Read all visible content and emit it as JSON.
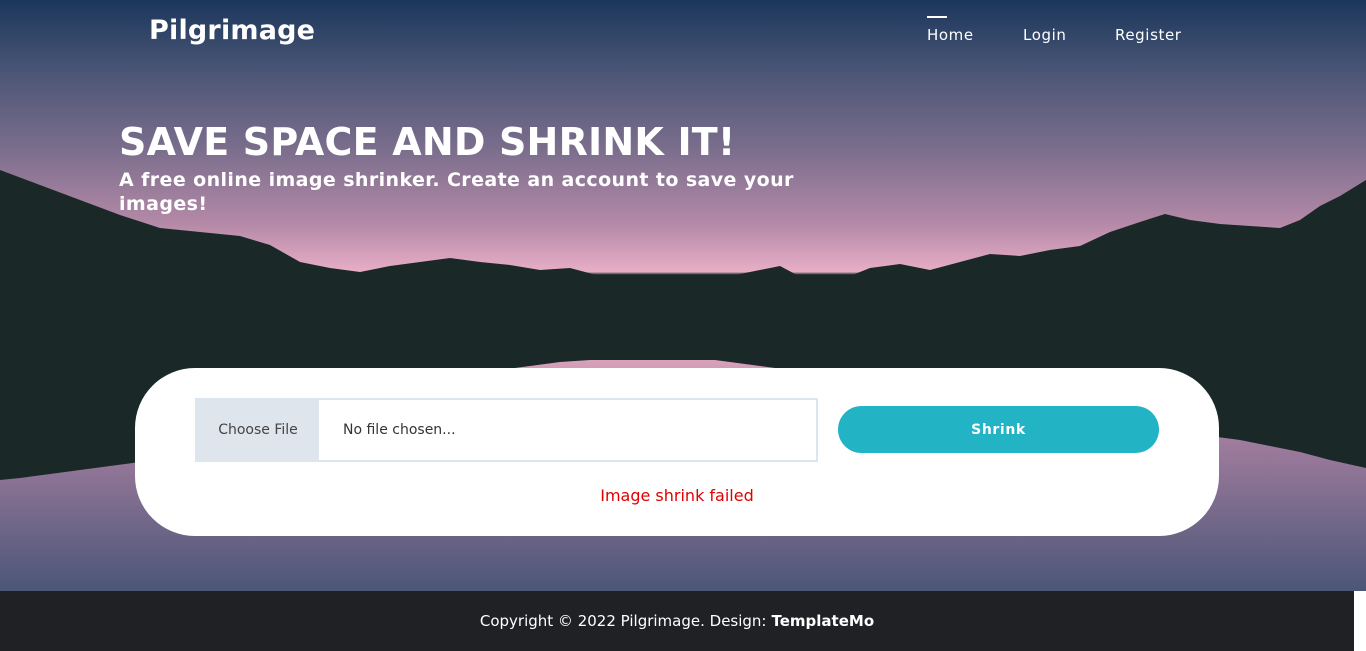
{
  "nav": {
    "brand": "Pilgrimage",
    "links": [
      {
        "label": "Home",
        "active": true
      },
      {
        "label": "Login"
      },
      {
        "label": "Register"
      }
    ]
  },
  "hero": {
    "title": "SAVE SPACE AND SHRINK IT!",
    "subtitle": "A free online image shrinker. Create an account to save your images!"
  },
  "upload": {
    "choose_label": "Choose File",
    "file_placeholder": "No file chosen...",
    "submit_label": "Shrink",
    "status_message": "Image shrink failed"
  },
  "footer": {
    "copyright": "Copyright © 2022 Pilgrimage. Design:",
    "credit": "TemplateMo"
  },
  "colors": {
    "accent": "#22b3c4",
    "error": "#e10000",
    "footer_bg": "#202124"
  }
}
